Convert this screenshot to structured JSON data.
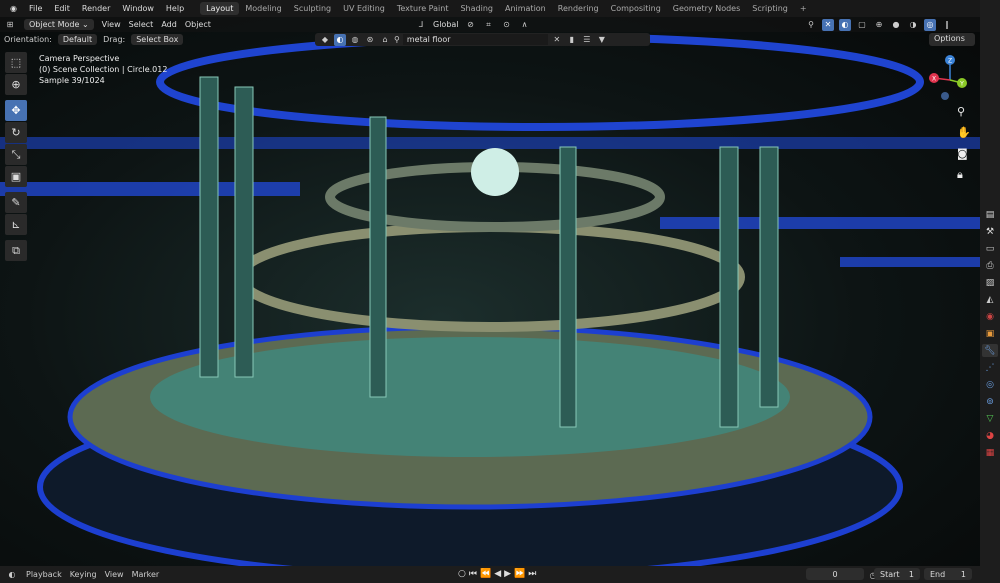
{
  "menu": [
    "File",
    "Edit",
    "Render",
    "Window",
    "Help"
  ],
  "workspaces": [
    "Layout",
    "Modeling",
    "Sculpting",
    "UV Editing",
    "Texture Paint",
    "Shading",
    "Animation",
    "Rendering",
    "Compositing",
    "Geometry Nodes",
    "Scripting"
  ],
  "active_workspace": "Layout",
  "add_workspace": "+",
  "header": {
    "mode": "Object Mode",
    "items": [
      "View",
      "Select",
      "Add",
      "Object"
    ],
    "transform_orientation": "Global"
  },
  "tool_settings": {
    "orientation_label": "Orientation:",
    "orientation_value": "Default",
    "drag_label": "Drag:",
    "drag_value": "Select Box",
    "options": "Options"
  },
  "search": {
    "value": "metal floor"
  },
  "overlay": {
    "line1": "Camera Perspective",
    "line2": "(0) Scene Collection | Circle.012",
    "line3": "Sample 39/1024"
  },
  "gizmo": {
    "x": "X",
    "y": "Y",
    "z": "Z"
  },
  "timeline": {
    "items": [
      "Playback",
      "Keying",
      "View",
      "Marker"
    ],
    "current_frame": "0",
    "start_label": "Start",
    "start": "1",
    "end_label": "End",
    "end": "1"
  },
  "colors": {
    "accent": "#4772b3",
    "x_axis": "#e0344e",
    "y_axis": "#8ac926",
    "z_axis": "#3b83d8"
  }
}
